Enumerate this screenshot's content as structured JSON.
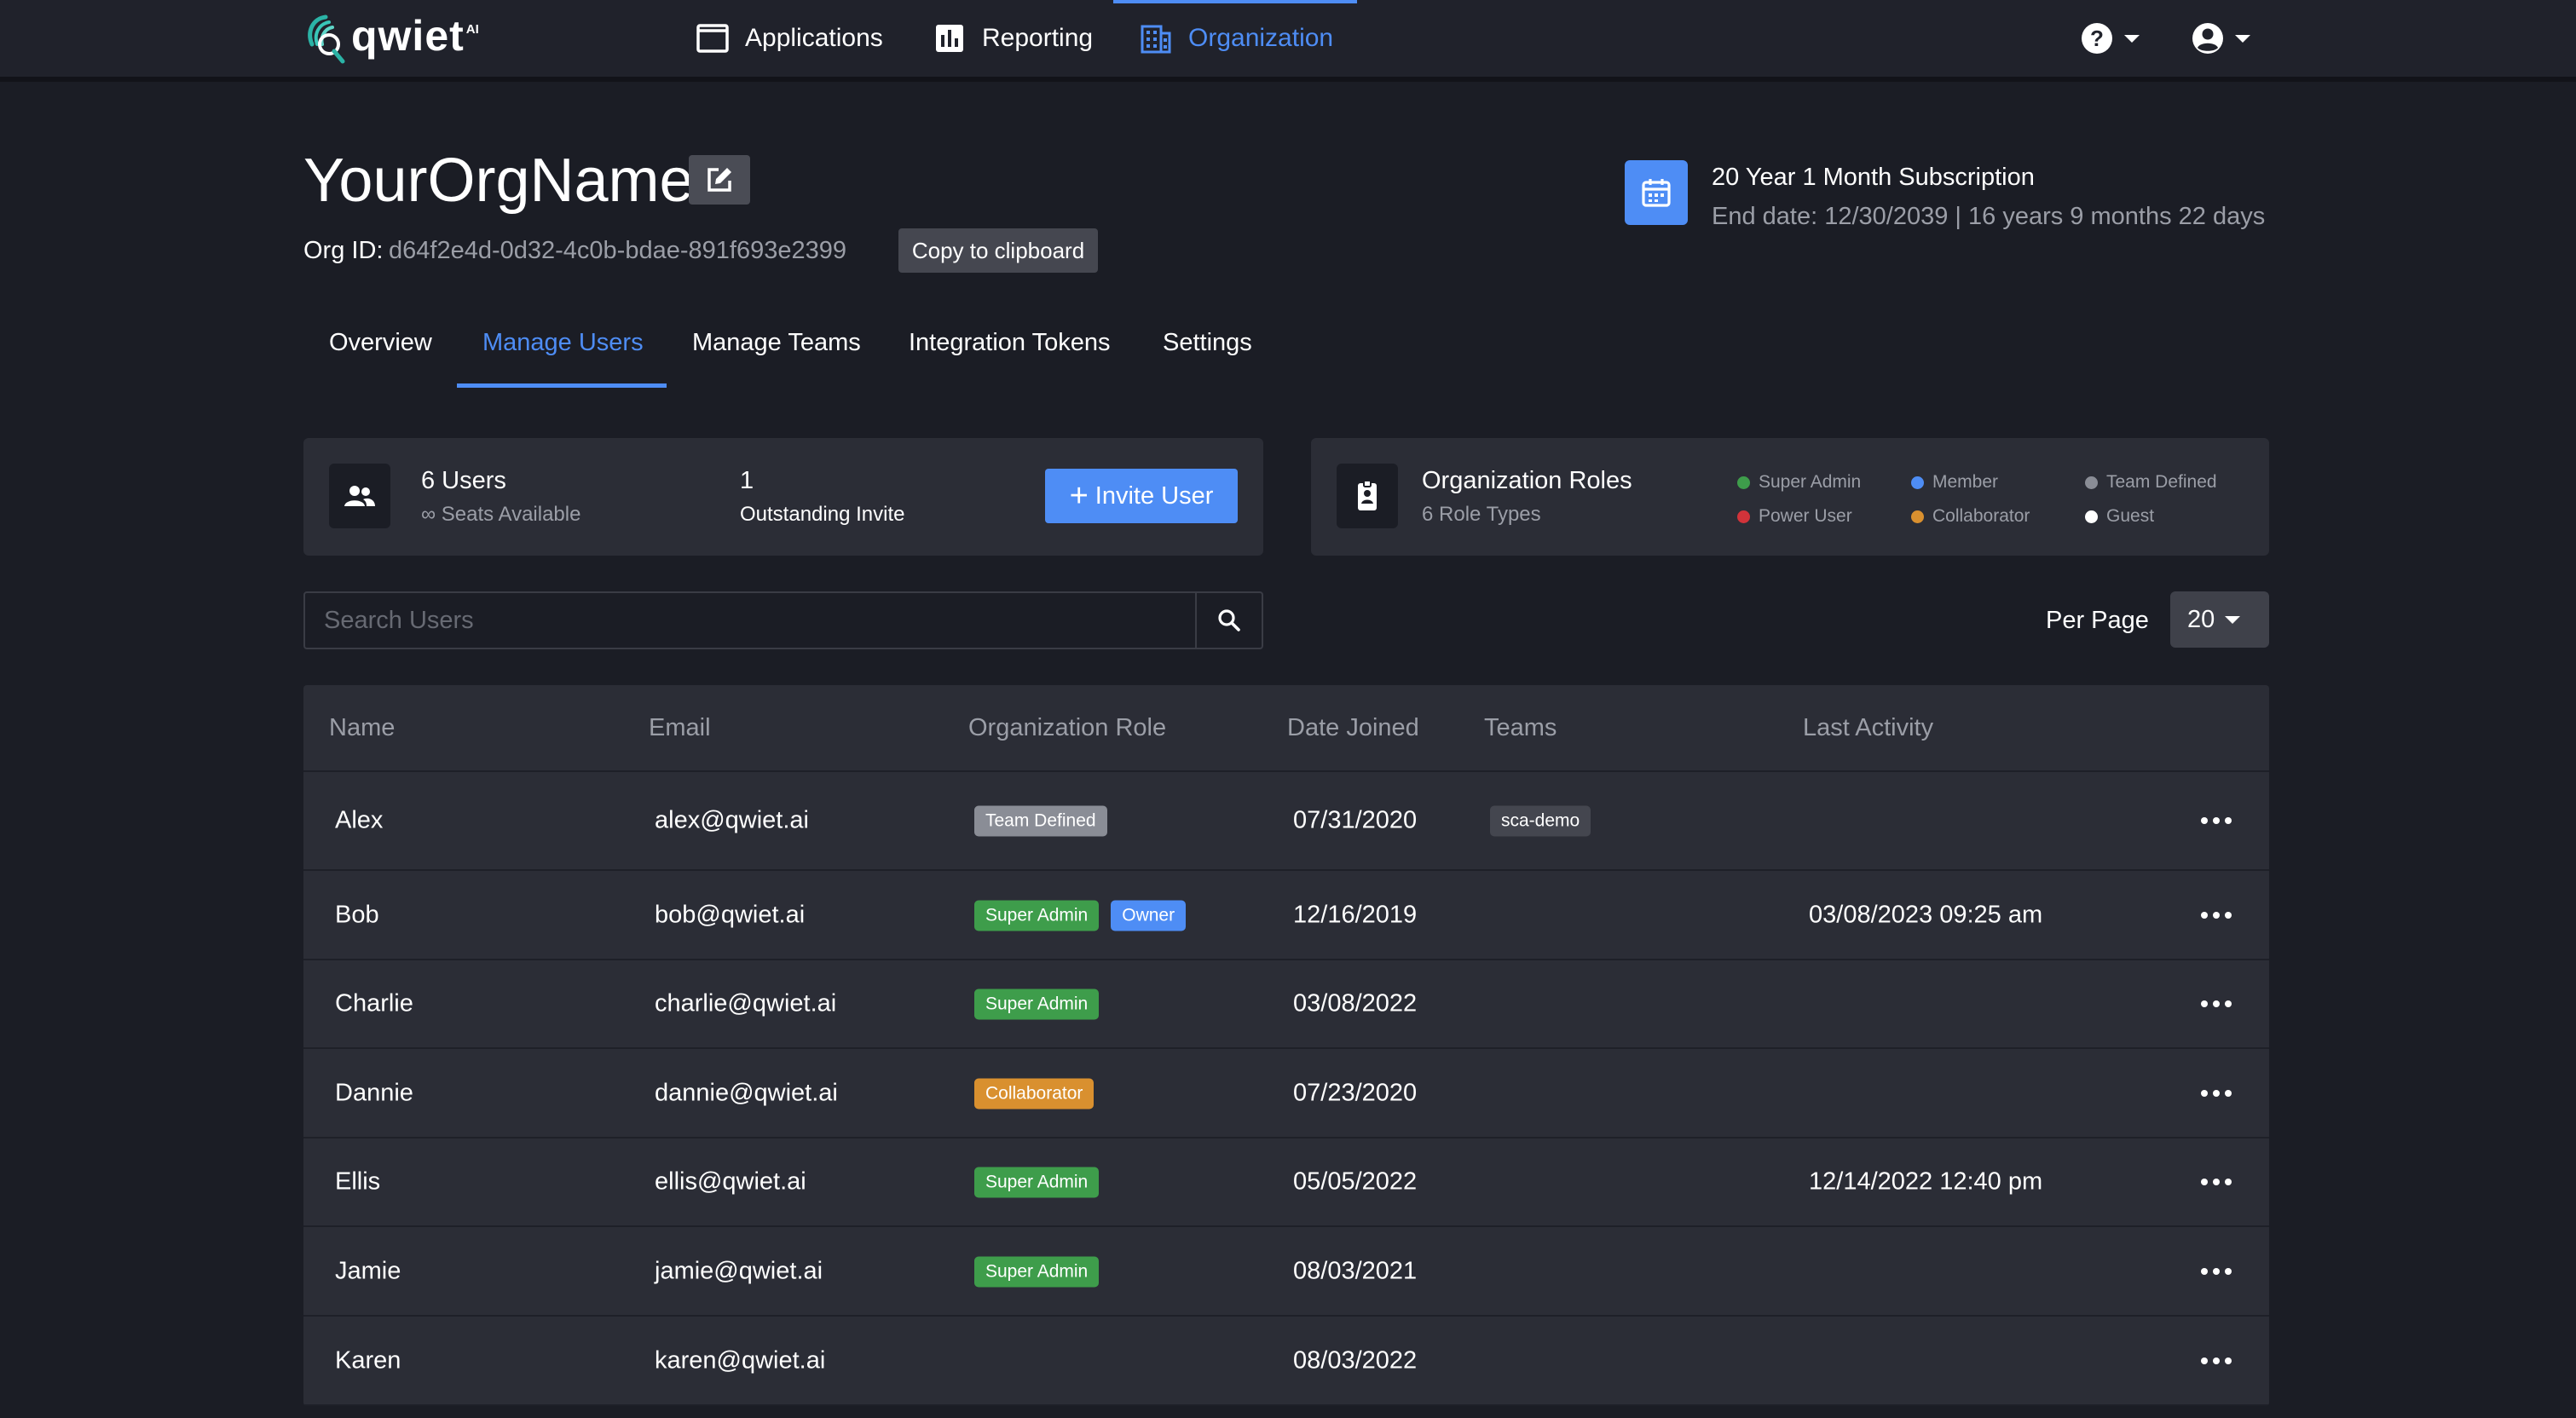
{
  "brand": {
    "logo_word": "qwiet",
    "logo_ai": "AI"
  },
  "nav": {
    "applications": "Applications",
    "reporting": "Reporting",
    "organization": "Organization"
  },
  "header": {
    "org_name": "YourOrgName",
    "org_id_label": "Org ID:",
    "org_id": "d64f2e4d-0d32-4c0b-bdae-891f693e2399",
    "copy_label": "Copy to clipboard",
    "subscription_title": "20 Year 1 Month Subscription",
    "subscription_end": "End date: 12/30/2039 | 16 years 9 months 22 days"
  },
  "tabs": [
    {
      "label": "Overview"
    },
    {
      "label": "Manage Users",
      "active": true
    },
    {
      "label": "Manage Teams"
    },
    {
      "label": "Integration Tokens"
    },
    {
      "label": "Settings"
    }
  ],
  "users_card": {
    "count_label": "6 Users",
    "seats_label": "∞ Seats Available",
    "invites_count": "1",
    "invites_label": "Outstanding Invite",
    "invite_button": "Invite User"
  },
  "roles_card": {
    "title": "Organization Roles",
    "subtitle": "6 Role Types",
    "legend": [
      {
        "label": "Super Admin",
        "color": "#3e9d4b"
      },
      {
        "label": "Member",
        "color": "#4e8df5"
      },
      {
        "label": "Team Defined",
        "color": "#8a8d96"
      },
      {
        "label": "Power User",
        "color": "#d1333a"
      },
      {
        "label": "Collaborator",
        "color": "#d9902f"
      },
      {
        "label": "Guest",
        "color": "#ffffff"
      }
    ]
  },
  "search": {
    "placeholder": "Search Users"
  },
  "per_page": {
    "label": "Per Page",
    "value": "20"
  },
  "table": {
    "columns": [
      "Name",
      "Email",
      "Organization Role",
      "Date Joined",
      "Teams",
      "Last Activity"
    ],
    "rows": [
      {
        "name": "Alex",
        "email": "alex@qwiet.ai",
        "roles": [
          "Team Defined"
        ],
        "joined": "07/31/2020",
        "teams": [
          "sca-demo"
        ],
        "last_activity": ""
      },
      {
        "name": "Bob",
        "email": "bob@qwiet.ai",
        "roles": [
          "Super Admin",
          "Owner"
        ],
        "joined": "12/16/2019",
        "teams": [],
        "last_activity": "03/08/2023 09:25 am"
      },
      {
        "name": "Charlie",
        "email": "charlie@qwiet.ai",
        "roles": [
          "Super Admin"
        ],
        "joined": "03/08/2022",
        "teams": [],
        "last_activity": ""
      },
      {
        "name": "Dannie",
        "email": "dannie@qwiet.ai",
        "roles": [
          "Collaborator"
        ],
        "joined": "07/23/2020",
        "teams": [],
        "last_activity": ""
      },
      {
        "name": "Ellis",
        "email": "ellis@qwiet.ai",
        "roles": [
          "Super Admin"
        ],
        "joined": "05/05/2022",
        "teams": [],
        "last_activity": "12/14/2022 12:40 pm"
      },
      {
        "name": "Jamie",
        "email": "jamie@qwiet.ai",
        "roles": [
          "Super Admin"
        ],
        "joined": "08/03/2021",
        "teams": [],
        "last_activity": ""
      },
      {
        "name": "Karen",
        "email": "karen@qwiet.ai",
        "roles": [],
        "joined": "08/03/2022",
        "teams": [],
        "last_activity": ""
      }
    ]
  },
  "colors": {
    "accent": "#4e8df5",
    "background": "#1b1d25",
    "panel": "#2b2d36",
    "super_admin": "#3e9d4b",
    "owner": "#4e8df5",
    "team_defined": "#8a8d96",
    "collaborator": "#d9902f"
  },
  "icons": {
    "applications": "window-icon",
    "reporting": "bar-chart-icon",
    "organization": "building-icon",
    "help": "question-circle-icon",
    "account": "user-circle-icon",
    "edit": "edit-icon",
    "calendar": "calendar-icon",
    "users": "users-icon",
    "roles": "id-badge-icon",
    "search": "search-icon",
    "more": "ellipsis-icon"
  }
}
